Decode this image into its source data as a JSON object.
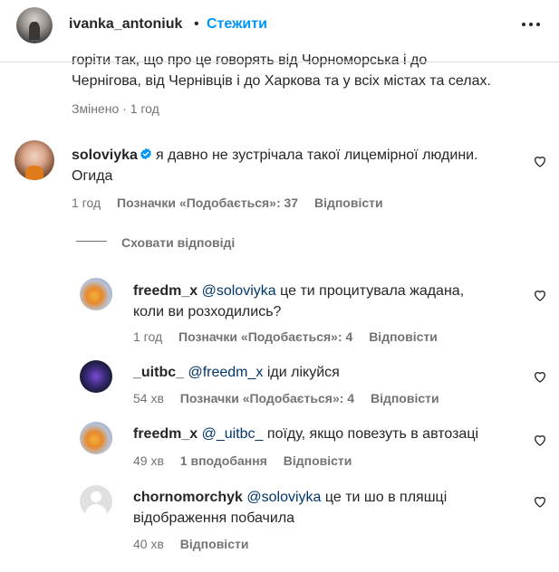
{
  "header": {
    "username": "ivanka_antoniuk",
    "separator": "•",
    "follow_label": "Стежити",
    "more_icon": "more-horizontal-icon"
  },
  "caption": {
    "tail_line1": "горіти так, що про це говорять від Чорноморська і до",
    "tail_line2": "Чернігова, від Чернівців і до Харкова та у всіх містах та селах.",
    "edited_label": "Змінено",
    "separator": "·",
    "time": "1 год"
  },
  "comment": {
    "username": "soloviyka",
    "verified_icon": "verified-badge-icon",
    "text_line1": "я давно не зустрічала такої лицемірної людини.",
    "text_line2": "Огида",
    "time": "1 год",
    "likes": "Позначки «Подобається»: 37",
    "reply_label": "Відповісти",
    "hide_replies_label": "Сховати відповіді"
  },
  "replies": [
    {
      "username": "freedm_x",
      "mention": "@soloviyka",
      "text_line1": "це ти процитувала жадана,",
      "text_line2": "коли ви розходились?",
      "time": "1 год",
      "likes": "Позначки «Подобається»: 4",
      "reply_label": "Відповісти"
    },
    {
      "username": "_uitbc_",
      "mention": "@freedm_x",
      "text_line1": "іди лікуйся",
      "time": "54 хв",
      "likes": "Позначки «Подобається»: 4",
      "reply_label": "Відповісти"
    },
    {
      "username": "freedm_x",
      "mention": "@_uitbc_",
      "text_line1": "поїду, якщо повезуть в автозаці",
      "time": "49 хв",
      "likes": "1 вподобання",
      "reply_label": "Відповісти"
    },
    {
      "username": "chornomorchyk",
      "mention": "@soloviyka",
      "text_line1": "це ти шо в пляшці",
      "text_line2": "відображення побачила",
      "time": "40 хв",
      "reply_label": "Відповісти"
    }
  ],
  "colors": {
    "accent": "#0095f6",
    "mention": "#00376b",
    "meta": "#737373",
    "verified": "#0095f6"
  }
}
